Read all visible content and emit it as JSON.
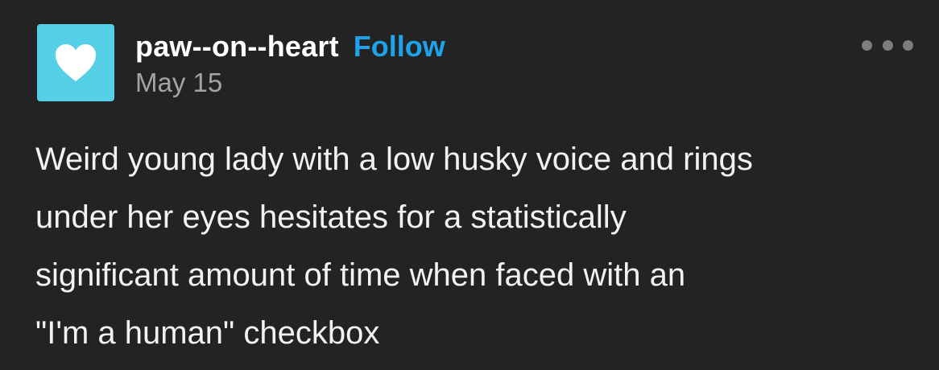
{
  "post": {
    "username": "paw--on--heart",
    "follow_label": "Follow",
    "date": "May 15",
    "avatar_icon": "heart-icon",
    "more_icon": "more-options-icon",
    "body_lines": [
      "Weird young lady with a low husky voice and rings",
      "under her eyes hesitates for a statistically",
      "significant amount of time when faced with an",
      "\"I'm a human\" checkbox"
    ]
  },
  "colors": {
    "background": "#232323",
    "avatar": "#56d0e6",
    "follow": "#1ea3ea",
    "date": "#a3a3a3",
    "text": "#f2f2f2"
  }
}
